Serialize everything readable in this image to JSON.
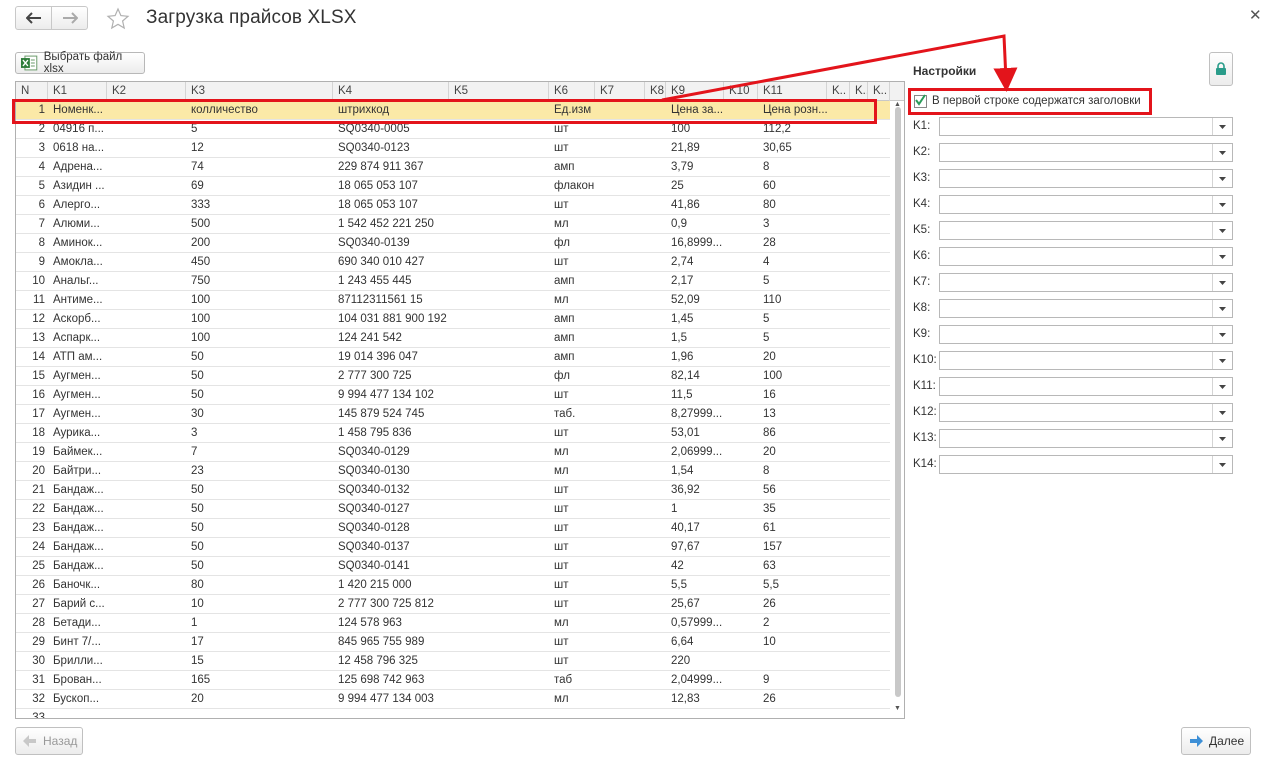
{
  "window": {
    "title": "Загрузка прайсов XLSX"
  },
  "toolbar": {
    "choose_file_label": "Выбрать файл xlsx"
  },
  "table": {
    "columns": [
      "N",
      "K1",
      "K2",
      "K3",
      "K4",
      "K5",
      "K6",
      "K7",
      "K8",
      "K9",
      "K10",
      "K11",
      "K..",
      "K..",
      "K.."
    ],
    "rows": [
      [
        "1",
        "Номенк...",
        "",
        "колличество",
        "штрихкод",
        "",
        "Ед.изм",
        "",
        "",
        "Цена за...",
        "",
        "Цена розн..."
      ],
      [
        "2",
        "04916 п...",
        "",
        "5",
        "SQ0340-0005",
        "",
        "шт",
        "",
        "",
        "100",
        "",
        "112,2"
      ],
      [
        "3",
        "0618 на...",
        "",
        "12",
        "SQ0340-0123",
        "",
        "шт",
        "",
        "",
        "21,89",
        "",
        "30,65"
      ],
      [
        "4",
        "Адрена...",
        "",
        "74",
        "229 874 911 367",
        "",
        "амп",
        "",
        "",
        "3,79",
        "",
        "8"
      ],
      [
        "5",
        "Азидин ...",
        "",
        "69",
        "18 065 053 107",
        "",
        "флакон",
        "",
        "",
        "25",
        "",
        "60"
      ],
      [
        "6",
        "Алерго...",
        "",
        "333",
        "18 065 053 107",
        "",
        "шт",
        "",
        "",
        "41,86",
        "",
        "80"
      ],
      [
        "7",
        "Алюми...",
        "",
        "500",
        "1 542 452 221 250",
        "",
        "мл",
        "",
        "",
        "0,9",
        "",
        "3"
      ],
      [
        "8",
        "Аминок...",
        "",
        "200",
        "SQ0340-0139",
        "",
        "фл",
        "",
        "",
        "16,8999...",
        "",
        "28"
      ],
      [
        "9",
        "Амокла...",
        "",
        "450",
        "690 340 010 427",
        "",
        "шт",
        "",
        "",
        "2,74",
        "",
        "4"
      ],
      [
        "10",
        "Анальг...",
        "",
        "750",
        "1 243 455 445",
        "",
        "амп",
        "",
        "",
        "2,17",
        "",
        "5"
      ],
      [
        "11",
        "Антиме...",
        "",
        "100",
        "87112311561 15",
        "",
        "мл",
        "",
        "",
        "52,09",
        "",
        "110"
      ],
      [
        "12",
        "Аскорб...",
        "",
        "100",
        "104 031 881 900 192",
        "",
        "амп",
        "",
        "",
        "1,45",
        "",
        "5"
      ],
      [
        "13",
        "Аспарк...",
        "",
        "100",
        "124 241 542",
        "",
        "амп",
        "",
        "",
        "1,5",
        "",
        "5"
      ],
      [
        "14",
        "АТП ам...",
        "",
        "50",
        "19 014 396 047",
        "",
        "амп",
        "",
        "",
        "1,96",
        "",
        "20"
      ],
      [
        "15",
        "Аугмен...",
        "",
        "50",
        "2 777 300 725",
        "",
        "фл",
        "",
        "",
        "82,14",
        "",
        "100"
      ],
      [
        "16",
        "Аугмен...",
        "",
        "50",
        "9 994 477 134 102",
        "",
        "шт",
        "",
        "",
        "11,5",
        "",
        "16"
      ],
      [
        "17",
        "Аугмен...",
        "",
        "30",
        "145 879 524 745",
        "",
        "таб.",
        "",
        "",
        "8,27999...",
        "",
        "13"
      ],
      [
        "18",
        "Аурика...",
        "",
        "3",
        "1 458 795 836",
        "",
        "шт",
        "",
        "",
        "53,01",
        "",
        "86"
      ],
      [
        "19",
        "Баймек...",
        "",
        "7",
        "SQ0340-0129",
        "",
        "мл",
        "",
        "",
        "2,06999...",
        "",
        "20"
      ],
      [
        "20",
        "Байтри...",
        "",
        "23",
        "SQ0340-0130",
        "",
        "мл",
        "",
        "",
        "1,54",
        "",
        "8"
      ],
      [
        "21",
        "Бандаж...",
        "",
        "50",
        "SQ0340-0132",
        "",
        "шт",
        "",
        "",
        "36,92",
        "",
        "56"
      ],
      [
        "22",
        "Бандаж...",
        "",
        "50",
        "SQ0340-0127",
        "",
        "шт",
        "",
        "",
        "1",
        "",
        "35"
      ],
      [
        "23",
        "Бандаж...",
        "",
        "50",
        "SQ0340-0128",
        "",
        "шт",
        "",
        "",
        "40,17",
        "",
        "61"
      ],
      [
        "24",
        "Бандаж...",
        "",
        "50",
        "SQ0340-0137",
        "",
        "шт",
        "",
        "",
        "97,67",
        "",
        "157"
      ],
      [
        "25",
        "Бандаж...",
        "",
        "50",
        "SQ0340-0141",
        "",
        "шт",
        "",
        "",
        "42",
        "",
        "63"
      ],
      [
        "26",
        "Баночк...",
        "",
        "80",
        "1 420 215 000",
        "",
        "шт",
        "",
        "",
        "5,5",
        "",
        "5,5"
      ],
      [
        "27",
        "Барий с...",
        "",
        "10",
        "2 777 300 725 812",
        "",
        "шт",
        "",
        "",
        "25,67",
        "",
        "26"
      ],
      [
        "28",
        "Бетади...",
        "",
        "1",
        "124 578 963",
        "",
        "мл",
        "",
        "",
        "0,57999...",
        "",
        "2"
      ],
      [
        "29",
        "Бинт 7/...",
        "",
        "17",
        "845 965 755 989",
        "",
        "шт",
        "",
        "",
        "6,64",
        "",
        "10"
      ],
      [
        "30",
        "Брилли...",
        "",
        "15",
        "12 458 796 325",
        "",
        "шт",
        "",
        "",
        "220",
        "",
        ""
      ],
      [
        "31",
        "Брован...",
        "",
        "165",
        "125 698 742 963",
        "",
        "таб",
        "",
        "",
        "2,04999...",
        "",
        "9"
      ],
      [
        "32",
        "Бускоп...",
        "",
        "20",
        "9 994 477 134 003",
        "",
        "мл",
        "",
        "",
        "12,83",
        "",
        "26"
      ],
      [
        "33",
        "",
        "",
        "",
        "",
        "",
        "",
        "",
        "",
        "",
        "",
        ""
      ]
    ]
  },
  "settings": {
    "title": "Настройки",
    "header_checkbox_label": "В первой строке содержатся заголовки",
    "header_checkbox_checked": true,
    "fields": [
      {
        "label": "K1:",
        "value": ""
      },
      {
        "label": "K2:",
        "value": ""
      },
      {
        "label": "K3:",
        "value": ""
      },
      {
        "label": "K4:",
        "value": ""
      },
      {
        "label": "K5:",
        "value": ""
      },
      {
        "label": "K6:",
        "value": ""
      },
      {
        "label": "K7:",
        "value": ""
      },
      {
        "label": "K8:",
        "value": ""
      },
      {
        "label": "K9:",
        "value": ""
      },
      {
        "label": "K10:",
        "value": ""
      },
      {
        "label": "K11:",
        "value": ""
      },
      {
        "label": "K12:",
        "value": ""
      },
      {
        "label": "K13:",
        "value": ""
      },
      {
        "label": "K14:",
        "value": ""
      }
    ]
  },
  "footer": {
    "back_label": "Назад",
    "next_label": "Далее"
  },
  "colors": {
    "highlight": "#e3141b",
    "selected_row": "#fbe9a7",
    "accent": "#2a9c8a"
  }
}
